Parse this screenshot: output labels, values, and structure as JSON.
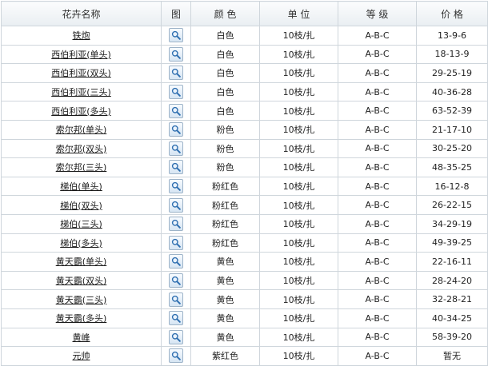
{
  "headers": {
    "name": "花卉名称",
    "image": "图",
    "color": "颜 色",
    "unit": "单 位",
    "grade": "等 级",
    "price": "价 格"
  },
  "rows": [
    {
      "name": "铁炮",
      "color": "白色",
      "unit": "10枝/扎",
      "grade": "A-B-C",
      "price": "13-9-6"
    },
    {
      "name": "西伯利亚(单头)",
      "color": "白色",
      "unit": "10枝/扎",
      "grade": "A-B-C",
      "price": "18-13-9"
    },
    {
      "name": "西伯利亚(双头)",
      "color": "白色",
      "unit": "10枝/扎",
      "grade": "A-B-C",
      "price": "29-25-19"
    },
    {
      "name": "西伯利亚(三头)",
      "color": "白色",
      "unit": "10枝/扎",
      "grade": "A-B-C",
      "price": "40-36-28"
    },
    {
      "name": "西伯利亚(多头)",
      "color": "白色",
      "unit": "10枝/扎",
      "grade": "A-B-C",
      "price": "63-52-39"
    },
    {
      "name": "索尔邦(单头)",
      "color": "粉色",
      "unit": "10枝/扎",
      "grade": "A-B-C",
      "price": "21-17-10"
    },
    {
      "name": "索尔邦(双头)",
      "color": "粉色",
      "unit": "10枝/扎",
      "grade": "A-B-C",
      "price": "30-25-20"
    },
    {
      "name": "索尔邦(三头)",
      "color": "粉色",
      "unit": "10枝/扎",
      "grade": "A-B-C",
      "price": "48-35-25"
    },
    {
      "name": "梯伯(单头)",
      "color": "粉红色",
      "unit": "10枝/扎",
      "grade": "A-B-C",
      "price": "16-12-8"
    },
    {
      "name": "梯伯(双头)",
      "color": "粉红色",
      "unit": "10枝/扎",
      "grade": "A-B-C",
      "price": "26-22-15"
    },
    {
      "name": "梯伯(三头)",
      "color": "粉红色",
      "unit": "10枝/扎",
      "grade": "A-B-C",
      "price": "34-29-19"
    },
    {
      "name": "梯伯(多头)",
      "color": "粉红色",
      "unit": "10枝/扎",
      "grade": "A-B-C",
      "price": "49-39-25"
    },
    {
      "name": "黄天霸(单头)",
      "color": "黄色",
      "unit": "10枝/扎",
      "grade": "A-B-C",
      "price": "22-16-11"
    },
    {
      "name": "黄天霸(双头)",
      "color": "黄色",
      "unit": "10枝/扎",
      "grade": "A-B-C",
      "price": "28-24-20"
    },
    {
      "name": "黄天霸(三头)",
      "color": "黄色",
      "unit": "10枝/扎",
      "grade": "A-B-C",
      "price": "32-28-21"
    },
    {
      "name": "黄天霸(多头)",
      "color": "黄色",
      "unit": "10枝/扎",
      "grade": "A-B-C",
      "price": "40-34-25"
    },
    {
      "name": "黄峰",
      "color": "黄色",
      "unit": "10枝/扎",
      "grade": "A-B-C",
      "price": "58-39-20"
    },
    {
      "name": "元帅",
      "color": "紫红色",
      "unit": "10枝/扎",
      "grade": "A-B-C",
      "price": "暂无"
    }
  ],
  "icons": {
    "image_view": "magnifier-icon"
  },
  "colors": {
    "border": "#cfd6dc",
    "header_bg": "#e9eef2",
    "icon_border": "#9db3c8",
    "icon_lens": "#2f6fb0"
  }
}
